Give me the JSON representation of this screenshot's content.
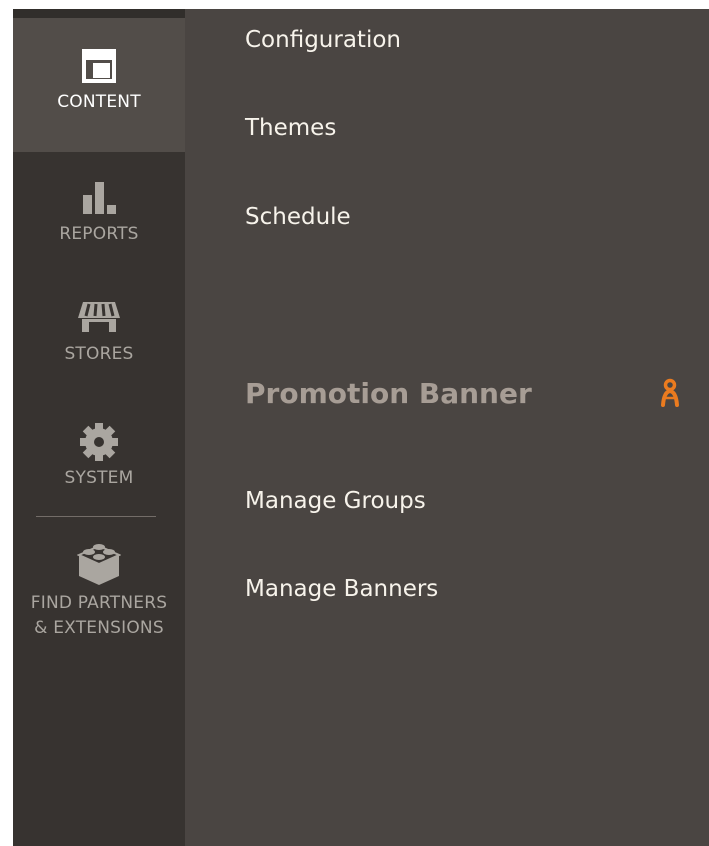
{
  "sidebar": {
    "items": [
      {
        "label": "CONTENT",
        "icon": "layout-icon",
        "active": true
      },
      {
        "label": "REPORTS",
        "icon": "bar-chart-icon",
        "active": false
      },
      {
        "label": "STORES",
        "icon": "storefront-icon",
        "active": false
      },
      {
        "label": "SYSTEM",
        "icon": "gear-icon",
        "active": false
      },
      {
        "label": "FIND PARTNERS\n& EXTENSIONS",
        "icon": "blocks-icon",
        "active": false
      }
    ]
  },
  "submenu": {
    "design_links": [
      "Configuration",
      "Themes",
      "Schedule"
    ],
    "section_title": "Promotion Banner",
    "section_logo_icon": "vendor-logo-icon",
    "section_links": [
      "Manage Groups",
      "Manage Banners"
    ]
  },
  "colors": {
    "panel_bg": "#4a4542",
    "sidebar_bg": "#373330",
    "active_bg": "#524d49",
    "link_text": "#f7f3eb",
    "title_text": "#a79d95",
    "accent": "#eb7b1f"
  }
}
